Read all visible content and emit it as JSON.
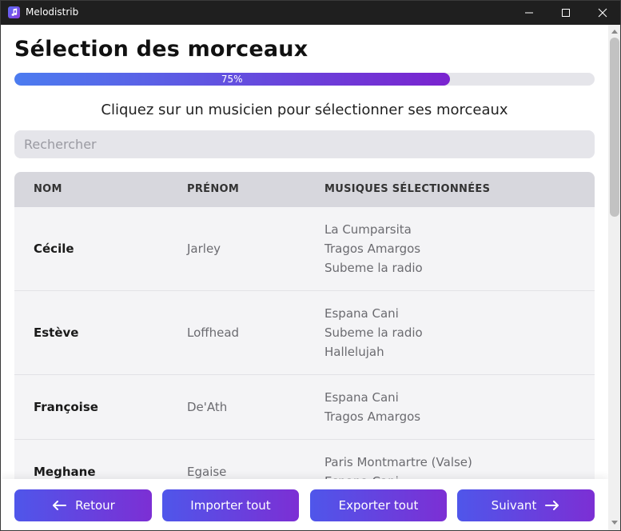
{
  "window": {
    "title": "Melodistrib",
    "icon": "music-note-icon"
  },
  "page": {
    "title": "Sélection des morceaux",
    "progress": {
      "value": 0.75,
      "label": "75%"
    },
    "instruction": "Cliquez sur un musicien pour sélectionner ses morceaux",
    "search": {
      "placeholder": "Rechercher",
      "value": ""
    }
  },
  "table": {
    "headers": [
      "NOM",
      "PRÉNOM",
      "MUSIQUES SÉLECTIONNÉES"
    ],
    "rows": [
      {
        "nom": "Cécile",
        "prenom": "Jarley",
        "musiques": [
          "La Cumparsita",
          "Tragos Amargos",
          "Subeme la radio"
        ]
      },
      {
        "nom": "Estève",
        "prenom": "Loffhead",
        "musiques": [
          "Espana Cani",
          "Subeme la radio",
          "Hallelujah"
        ]
      },
      {
        "nom": "Françoise",
        "prenom": "De'Ath",
        "musiques": [
          "Espana Cani",
          "Tragos Amargos"
        ]
      },
      {
        "nom": "Meghane",
        "prenom": "Egaise",
        "musiques": [
          "Paris Montmartre (Valse)",
          "Espana Cani"
        ]
      }
    ]
  },
  "footer": {
    "retour_label": "Retour",
    "import_label": "Importer tout",
    "export_label": "Exporter tout",
    "suivant_label": "Suivant"
  },
  "colors": {
    "accent_start": "#4f56ea",
    "accent_end": "#7c2fd4",
    "progress_start": "#4c7cf0",
    "progress_end": "#7a23cf"
  }
}
